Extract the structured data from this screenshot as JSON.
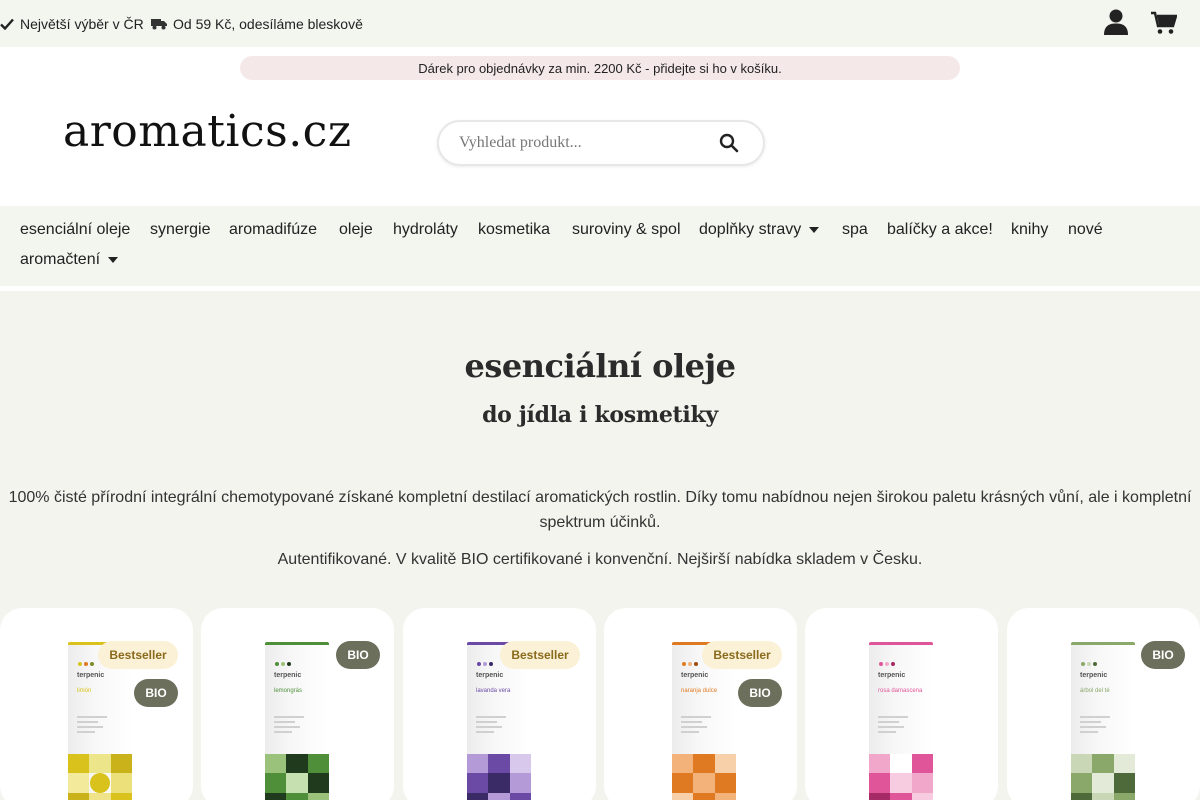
{
  "topbar": {
    "usp1": "Největší výběr v ČR",
    "usp2": "Od 59 Kč, odesíláme bleskově",
    "icons": [
      "check-icon",
      "truck-icon",
      "user-icon",
      "cart-icon"
    ]
  },
  "promo": {
    "text": "Dárek pro objednávky za min. 2200 Kč - přidejte si ho v košíku."
  },
  "header": {
    "logo": "aromatics.cz",
    "search_placeholder": "Vyhledat produkt..."
  },
  "nav": {
    "items": [
      {
        "label": "esenciální oleje"
      },
      {
        "label": "synergie"
      },
      {
        "label": "aromadifúze"
      },
      {
        "label": "oleje"
      },
      {
        "label": "hydroláty"
      },
      {
        "label": "kosmetika"
      },
      {
        "label": "suroviny & spol"
      },
      {
        "label": "doplňky stravy",
        "dropdown": true
      },
      {
        "label": "spa"
      },
      {
        "label": "balíčky a akce!"
      },
      {
        "label": "knihy"
      },
      {
        "label": "nové"
      },
      {
        "label": "aromačtení",
        "dropdown": true
      }
    ]
  },
  "hero": {
    "title": "esenciální oleje",
    "subtitle": "do jídla i kosmetiky",
    "paragraph1": "100% čisté přírodní integrální chemotypované získané kompletní destilací aromatických rostlin. Díky tomu nabídnou nejen širokou paletu krásných vůní, ale i kompletní spektrum účinků.",
    "paragraph2": "Autentifikované. V kvalitě BIO certifikované i konvenční. Nejširší nabídka skladem v Česku."
  },
  "products": [
    {
      "brand": "terpenic",
      "name": "limón",
      "badges": [
        "Bestseller",
        "BIO"
      ],
      "color": "#d9c21b",
      "accent": "#7a8f2a"
    },
    {
      "brand": "terpenic",
      "name": "lemongrás",
      "badges": [
        "BIO"
      ],
      "color": "#4f8f3a",
      "accent": "#1f3a1c"
    },
    {
      "brand": "terpenic",
      "name": "lavanda vera",
      "badges": [
        "Bestseller"
      ],
      "color": "#6b4aa6",
      "accent": "#b49ad6"
    },
    {
      "brand": "terpenic",
      "name": "naranja dulce",
      "badges": [
        "Bestseller",
        "BIO"
      ],
      "color": "#e07a22",
      "accent": "#f3b27a"
    },
    {
      "brand": "terpenic",
      "name": "rosa damascena",
      "badges": [],
      "color": "#e0559a",
      "accent": "#f1a7c9"
    },
    {
      "brand": "terpenic",
      "name": "árbol del té",
      "badges": [
        "BIO"
      ],
      "color": "#8aa86a",
      "accent": "#c9d7b6"
    }
  ]
}
